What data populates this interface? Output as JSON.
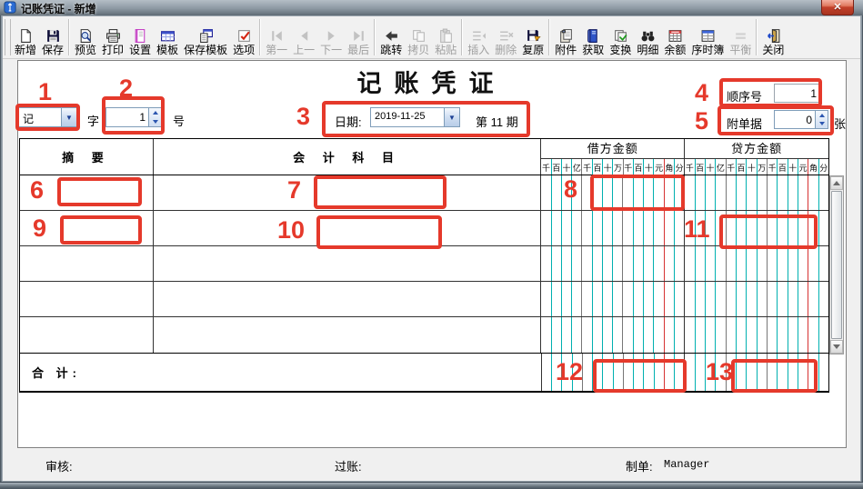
{
  "window": {
    "title": "记账凭证 - 新增"
  },
  "toolbar": {
    "groups": [
      [
        {
          "label": "新增",
          "icon": "new-document",
          "enabled": true
        },
        {
          "label": "保存",
          "icon": "save",
          "enabled": true
        }
      ],
      [
        {
          "label": "预览",
          "icon": "print-preview",
          "enabled": true
        },
        {
          "label": "打印",
          "icon": "printer",
          "enabled": true
        },
        {
          "label": "设置",
          "icon": "page-setup",
          "enabled": true
        },
        {
          "label": "模板",
          "icon": "template",
          "enabled": true
        },
        {
          "label": "保存模板",
          "icon": "save-template",
          "enabled": true
        },
        {
          "label": "选项",
          "icon": "options-check",
          "enabled": true
        }
      ],
      [
        {
          "label": "第一",
          "icon": "nav-first",
          "enabled": false
        },
        {
          "label": "上一",
          "icon": "nav-previous",
          "enabled": false
        },
        {
          "label": "下一",
          "icon": "nav-next",
          "enabled": false
        },
        {
          "label": "最后",
          "icon": "nav-last",
          "enabled": false
        }
      ],
      [
        {
          "label": "跳转",
          "icon": "jump-arrow",
          "enabled": true
        },
        {
          "label": "拷贝",
          "icon": "copy",
          "enabled": false
        },
        {
          "label": "粘贴",
          "icon": "paste",
          "enabled": false
        }
      ],
      [
        {
          "label": "插入",
          "icon": "insert-row",
          "enabled": false
        },
        {
          "label": "删除",
          "icon": "delete-row",
          "enabled": false
        },
        {
          "label": "复原",
          "icon": "restore",
          "enabled": true
        }
      ],
      [
        {
          "label": "附件",
          "icon": "attachment",
          "enabled": true
        },
        {
          "label": "获取",
          "icon": "fetch-book",
          "enabled": true
        },
        {
          "label": "变换",
          "icon": "transform",
          "enabled": true
        },
        {
          "label": "明细",
          "icon": "detail-binoculars",
          "enabled": true
        },
        {
          "label": "余额",
          "icon": "balance-table",
          "enabled": true
        },
        {
          "label": "序时簿",
          "icon": "journal-window",
          "enabled": true
        },
        {
          "label": "平衡",
          "icon": "balance-equal",
          "enabled": false
        }
      ],
      [
        {
          "label": "关闭",
          "icon": "close-door",
          "enabled": true
        }
      ]
    ]
  },
  "voucher": {
    "title": "记账凭证",
    "word": {
      "value": "记",
      "word_suffix": "字",
      "number_value": "1",
      "number_suffix": "号"
    },
    "date": {
      "label": "日期:",
      "value": "2019-11-25",
      "period_text": "第 11 期"
    },
    "sequence": {
      "label": "顺序号",
      "value": "1"
    },
    "attachments": {
      "label": "附单据",
      "value": "0",
      "unit": "张"
    },
    "table": {
      "summary_header": "摘  要",
      "subject_header": "会 计 科 目",
      "debit_header": "借方金额",
      "credit_header": "贷方金额",
      "digit_labels": [
        "千",
        "百",
        "十",
        "亿",
        "千",
        "百",
        "十",
        "万",
        "千",
        "百",
        "十",
        "元",
        "角",
        "分"
      ],
      "rows": [
        {
          "summary": "",
          "subject": "",
          "debit": "",
          "credit": ""
        },
        {
          "summary": "",
          "subject": "",
          "debit": "",
          "credit": ""
        },
        {
          "summary": "",
          "subject": "",
          "debit": "",
          "credit": ""
        },
        {
          "summary": "",
          "subject": "",
          "debit": "",
          "credit": ""
        },
        {
          "summary": "",
          "subject": "",
          "debit": "",
          "credit": ""
        }
      ],
      "total_label": "合  计:",
      "total_debit": "",
      "total_credit": ""
    },
    "footer": {
      "review_label": "审核:",
      "post_label": "过账:",
      "prepare_label": "制单:",
      "preparer": "Manager"
    }
  },
  "annotations": [
    {
      "n": "1"
    },
    {
      "n": "2"
    },
    {
      "n": "3"
    },
    {
      "n": "4"
    },
    {
      "n": "5"
    },
    {
      "n": "6"
    },
    {
      "n": "7"
    },
    {
      "n": "8"
    },
    {
      "n": "9"
    },
    {
      "n": "10"
    },
    {
      "n": "11"
    },
    {
      "n": "12"
    },
    {
      "n": "13"
    }
  ],
  "colors": {
    "grid_line_cyan": "#00b0b0",
    "grid_line_red": "#d63333",
    "group_separator": "#777777",
    "annotation_red": "#e5392b",
    "field_border": "#7f9db9"
  }
}
